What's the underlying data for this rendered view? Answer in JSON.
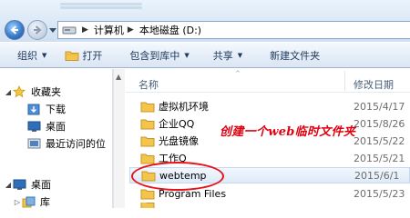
{
  "address": {
    "segments": [
      "计算机",
      "本地磁盘 (D:)"
    ]
  },
  "toolbar": {
    "organize": "组织",
    "open": "打开",
    "include_in_library": "包含到库中",
    "share": "共享",
    "new_folder": "新建文件夹"
  },
  "nav": {
    "favorites": "收藏夹",
    "downloads": "下载",
    "desktop": "桌面",
    "recent_places": "最近访问的位",
    "desktop_root": "桌面",
    "libraries": "库"
  },
  "columns": {
    "name": "名称",
    "date_modified": "修改日期"
  },
  "files": [
    {
      "name": "虚拟机环境",
      "date": "2015/4/17"
    },
    {
      "name": "企业QQ",
      "date": "2015/8/26"
    },
    {
      "name": "光盘镜像",
      "date": "2015/5/22"
    },
    {
      "name": "工作Q",
      "date": "2015/5/21"
    },
    {
      "name": "webtemp",
      "date": "2015/6/1"
    },
    {
      "name": "Program Files",
      "date": "2015/5/23"
    }
  ],
  "annotation": "创建一个web临时文件夹",
  "colors": {
    "accent": "#e8121a",
    "folder": "#f3c54a",
    "toolbar_text": "#1e395b"
  }
}
